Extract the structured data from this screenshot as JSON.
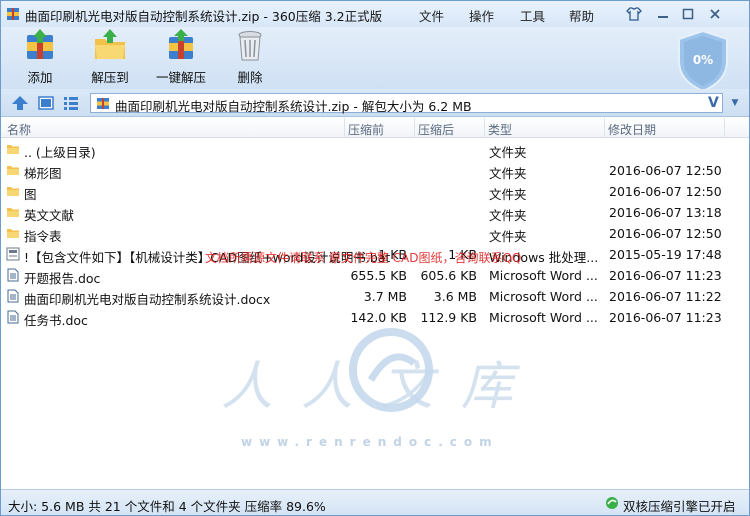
{
  "window": {
    "title": "曲面印刷机光电对版自动控制系统设计.zip - 360压缩 3.2正式版",
    "menu": [
      "文件",
      "操作",
      "工具",
      "帮助"
    ]
  },
  "toolbar": {
    "buttons": [
      {
        "label": "添加",
        "icon": "add-archive-icon"
      },
      {
        "label": "解压到",
        "icon": "extract-folder-icon"
      },
      {
        "label": "一键解压",
        "icon": "one-click-extract-icon"
      },
      {
        "label": "删除",
        "icon": "trash-can-icon"
      }
    ],
    "shield_percent": "0%"
  },
  "address": {
    "text": "曲面印刷机光电对版自动控制系统设计.zip - 解包大小为 6.2 MB",
    "v_label": "V"
  },
  "columns": {
    "name": "名称",
    "before": "压缩前",
    "after": "压缩后",
    "type": "类型",
    "date": "修改日期"
  },
  "files": [
    {
      "icon": "folder-icon",
      "name": ".. (上级目录)",
      "before": "",
      "after": "",
      "type": "文件夹",
      "date": ""
    },
    {
      "icon": "folder-icon",
      "name": "梯形图",
      "before": "",
      "after": "",
      "type": "文件夹",
      "date": "2016-06-07 12:50"
    },
    {
      "icon": "folder-icon",
      "name": "图",
      "before": "",
      "after": "",
      "type": "文件夹",
      "date": "2016-06-07 12:50"
    },
    {
      "icon": "folder-icon",
      "name": "英文文献",
      "before": "",
      "after": "",
      "type": "文件夹",
      "date": "2016-06-07 13:18"
    },
    {
      "icon": "folder-icon",
      "name": "指令表",
      "before": "",
      "after": "",
      "type": "文件夹",
      "date": "2016-06-07 12:50"
    },
    {
      "icon": "bat-file-icon",
      "name": "!【包含文件如下】【机械设计类】CAD图纸+word设计说明书.bat",
      "before": "1 KB",
      "after": "1 KB",
      "type": "Windows 批处理...",
      "date": "2015-05-19 17:48"
    },
    {
      "icon": "doc-file-icon",
      "name": "开题报告.doc",
      "before": "655.5 KB",
      "after": "605.6 KB",
      "type": "Microsoft Word ...",
      "date": "2016-06-07 11:23"
    },
    {
      "icon": "doc-file-icon",
      "name": "曲面印刷机光电对版自动控制系统设计.docx",
      "before": "3.7 MB",
      "after": "3.6 MB",
      "type": "Microsoft Word ...",
      "date": "2016-06-07 11:22"
    },
    {
      "icon": "doc-file-icon",
      "name": "任务书.doc",
      "before": "142.0 KB",
      "after": "112.9 KB",
      "type": "Microsoft Word ...",
      "date": "2016-06-07 11:23"
    }
  ],
  "watermark": {
    "chinese": "人人文库",
    "url": "www.renrendoc.com",
    "red_note": "文档所需源文件请联系 原文件完整 CAD图纸，咨询联系QQ"
  },
  "status": {
    "summary": "大小: 5.6 MB 共 21 个文件和 4 个文件夹 压缩率 89.6%",
    "engine": "双核压缩引擎已开启"
  },
  "colors": {
    "accent": "#3b6aa8",
    "folder": "#f2c14e",
    "watermark": "#c6d9ec"
  }
}
